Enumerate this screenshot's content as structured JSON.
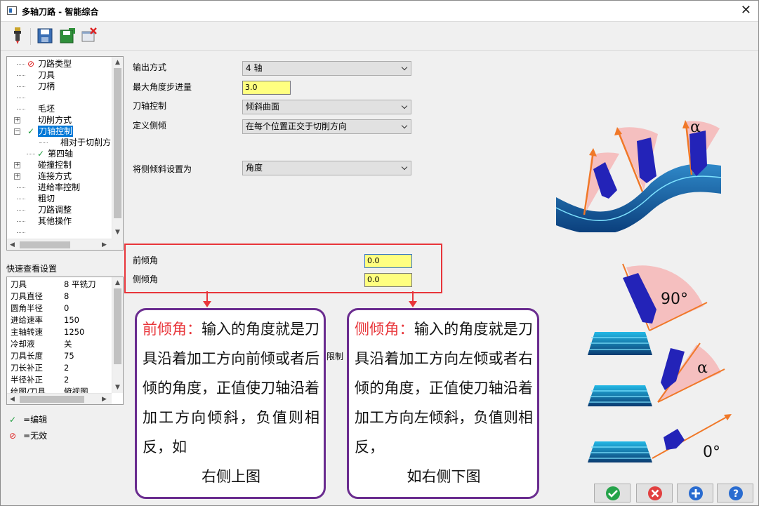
{
  "window": {
    "title": "多轴刀路 - 智能综合",
    "close_glyph": "✕"
  },
  "tree": {
    "items": [
      {
        "label": "刀路类型",
        "icon": "no-entry-icon"
      },
      {
        "label": "刀具"
      },
      {
        "label": "刀柄"
      },
      {
        "label": ""
      },
      {
        "label": "毛坯"
      },
      {
        "label": "切削方式",
        "expand": "+"
      },
      {
        "label": "刀轴控制",
        "expand": "−",
        "icon": "check-icon",
        "selected": true
      },
      {
        "label": "相对于切削方向"
      },
      {
        "label": "第四轴",
        "icon": "check-icon"
      },
      {
        "label": "碰撞控制",
        "expand": "+"
      },
      {
        "label": "连接方式",
        "expand": "+"
      },
      {
        "label": "进给率控制"
      },
      {
        "label": "粗切"
      },
      {
        "label": "刀路调整"
      },
      {
        "label": "其他操作"
      },
      {
        "label": ""
      }
    ]
  },
  "quickview": {
    "label": "快速查看设置",
    "rows": [
      {
        "k": "刀具",
        "v": "8 平铣刀"
      },
      {
        "k": "刀具直径",
        "v": "8"
      },
      {
        "k": "圆角半径",
        "v": "0"
      },
      {
        "k": "进给速率",
        "v": "150"
      },
      {
        "k": "主轴转速",
        "v": "1250"
      },
      {
        "k": "冷却液",
        "v": "关"
      },
      {
        "k": "刀具长度",
        "v": "75"
      },
      {
        "k": "刀长补正",
        "v": "2"
      },
      {
        "k": "半径补正",
        "v": "2"
      },
      {
        "k": "绘图/刀具",
        "v": "俯视图"
      }
    ]
  },
  "legend": {
    "edit": "=编辑",
    "invalid": "=无效"
  },
  "form": {
    "output_label": "输出方式",
    "output_value": "4 轴",
    "max_step_label": "最大角度步进量",
    "max_step_value": "3.0",
    "axis_ctrl_label": "刀轴控制",
    "axis_ctrl_value": "倾斜曲面",
    "side_def_label": "定义侧倾",
    "side_def_value": "在每个位置正交于切削方向",
    "side_set_label": "将侧倾斜设置为",
    "side_set_value": "角度",
    "lead_label": "前倾角",
    "lead_value": "0.0",
    "side_label": "侧倾角",
    "side_value": "0.0",
    "partial_label": "限制"
  },
  "callouts": {
    "front_title": "前倾角：",
    "front_body": "输入的角度就是刀具沿着加工方向前倾或者后倾的角度，正值使刀轴沿着加工方向倾斜，负值则相反，如",
    "front_tail": "右侧上图",
    "side_title": "侧倾角：",
    "side_body": "输入的角度就是刀具沿着加工方向左倾或者右倾的角度，正值使刀轴沿着加工方向左倾斜，负值则相反，",
    "side_tail": "如右侧下图"
  },
  "diagram_labels": {
    "alpha_top": "α",
    "deg90": "90°",
    "alpha_mid": "α",
    "deg0": "0°"
  },
  "colors": {
    "accent_red": "#e8353a",
    "callout_border": "#6a2c8f",
    "input_yellow": "#ffff80",
    "tool_blue": "#2020c0"
  }
}
